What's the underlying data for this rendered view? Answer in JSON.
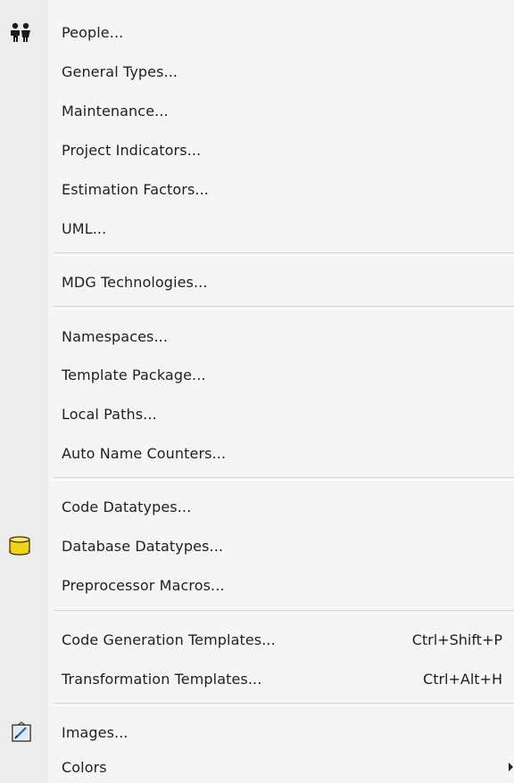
{
  "menu": {
    "items": [
      {
        "label": "People...",
        "icon": "people-icon"
      },
      {
        "label": "General Types..."
      },
      {
        "label": "Maintenance..."
      },
      {
        "label": "Project Indicators..."
      },
      {
        "label": "Estimation Factors..."
      },
      {
        "label": "UML..."
      },
      {
        "label": "MDG Technologies..."
      },
      {
        "label": "Namespaces..."
      },
      {
        "label": "Template Package..."
      },
      {
        "label": "Local Paths..."
      },
      {
        "label": "Auto Name Counters..."
      },
      {
        "label": "Code Datatypes..."
      },
      {
        "label": "Database Datatypes...",
        "icon": "database-icon"
      },
      {
        "label": "Preprocessor Macros..."
      },
      {
        "label": "Code Generation Templates...",
        "shortcut": "Ctrl+Shift+P"
      },
      {
        "label": "Transformation Templates...",
        "shortcut": "Ctrl+Alt+H"
      },
      {
        "label": "Images...",
        "icon": "image-icon"
      },
      {
        "label": "Colors",
        "submenu": true
      }
    ]
  },
  "colors": {
    "database_icon": "#f2d21a",
    "menu_background": "#f5f5f5"
  }
}
